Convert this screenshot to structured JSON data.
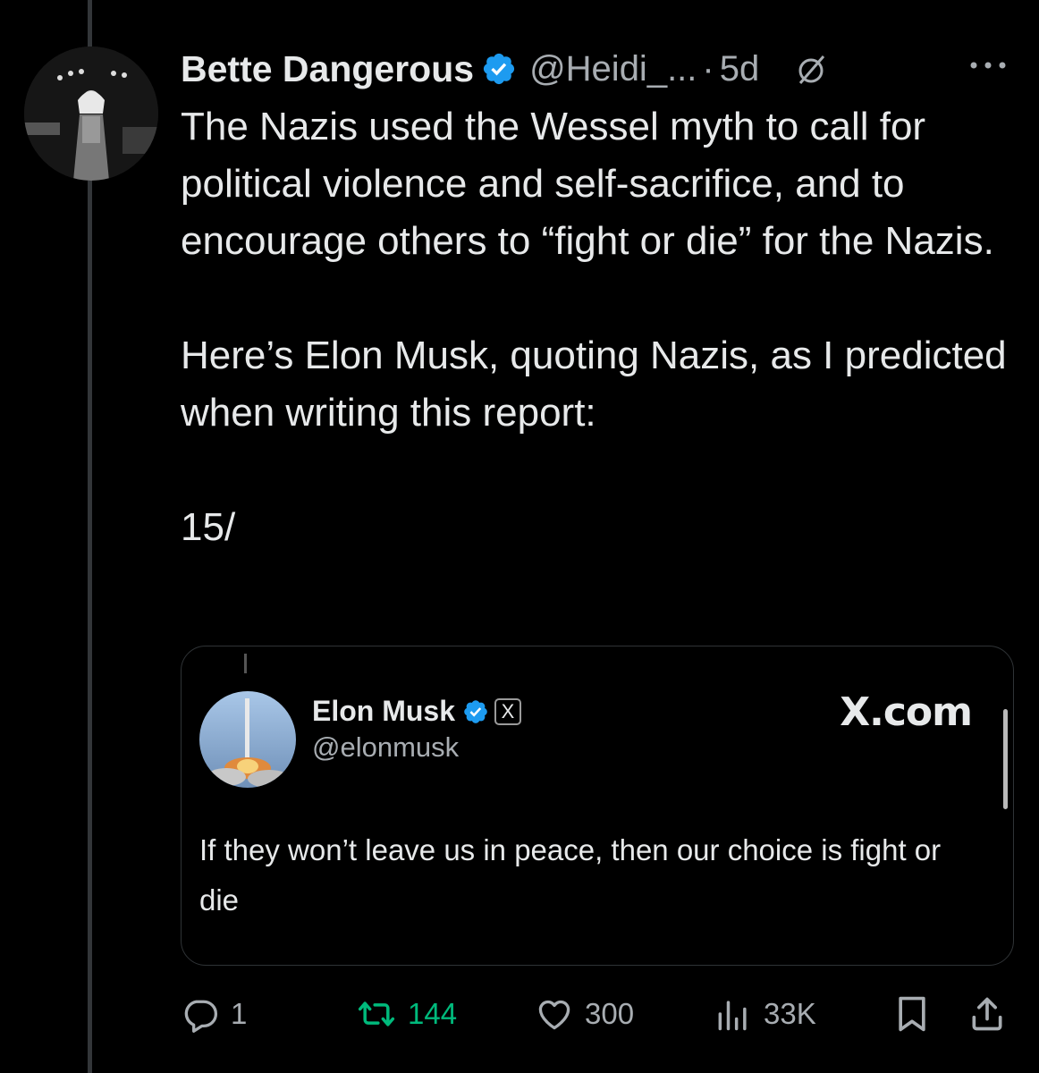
{
  "tweet": {
    "display_name": "Bette Dangerous",
    "verified_icon": "verified-badge-icon",
    "handle": "@Heidi_...",
    "separator": "·",
    "time": "5d",
    "mute_icon": "muted-icon",
    "more_icon": "more-options-icon",
    "paragraphs": [
      "The Nazis used the Wessel myth to call for political violence and self-sacrifice, and to encourage others to “fight or die” for the Nazis.",
      "Here’s Elon Musk, quoting Nazis, as I predicted when writing this report:",
      "15/"
    ]
  },
  "quote": {
    "name": "Elon Musk",
    "x_badge": "X",
    "handle": "@elonmusk",
    "site": "X.com",
    "text": "If they won’t leave us in peace, then our choice is fight or die"
  },
  "actions": {
    "reply_count": "1",
    "repost_count": "144",
    "like_count": "300",
    "views_count": "33K"
  },
  "colors": {
    "background": "#000000",
    "text": "#e7e9ea",
    "secondary": "#a8adb2",
    "verified": "#1d9bf0",
    "repost_active": "#00ba7c",
    "border": "#2f3336"
  }
}
